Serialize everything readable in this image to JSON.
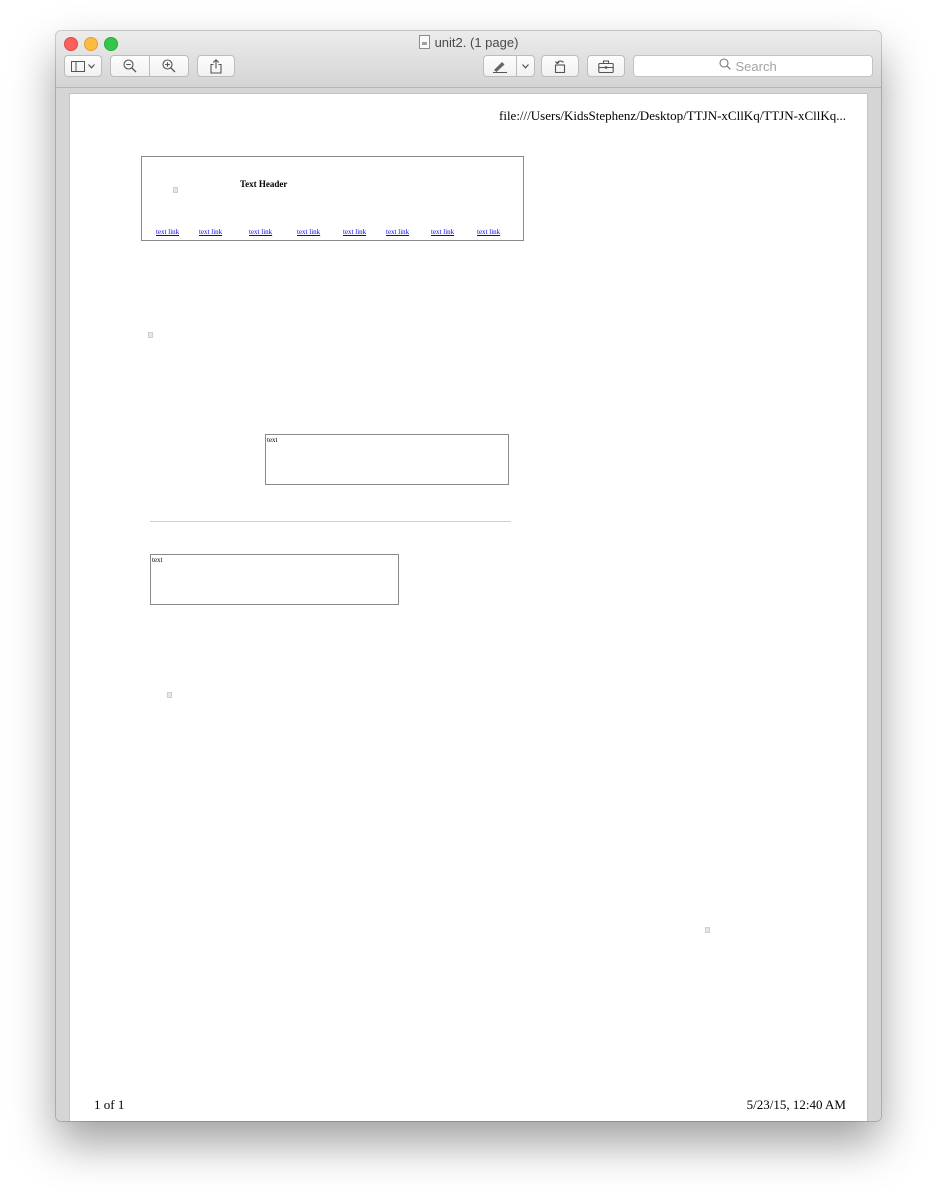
{
  "window": {
    "title": "unit2. (1 page)"
  },
  "toolbar": {
    "search_placeholder": "Search",
    "icons": [
      "sidebar-icon",
      "chevron-down-icon",
      "zoom-out-icon",
      "zoom-in-icon",
      "share-icon",
      "markup-pen-icon",
      "chevron-down-icon",
      "rotate-icon",
      "toolbox-icon",
      "search-icon"
    ]
  },
  "page": {
    "header_url": "file:///Users/KidsStephenz/Desktop/TTJN-xCllKq/TTJN-xCllKq...",
    "footer_page": "1 of 1",
    "footer_datetime": "5/23/15, 12:40 AM",
    "banner": {
      "title": "Text Header",
      "links": [
        "text link",
        "text link",
        "text link",
        "text link",
        "text link",
        "text link",
        "text link",
        "text link"
      ]
    },
    "textbox_1": "text",
    "textbox_2": "text"
  },
  "colors": {
    "link": "#0000ee",
    "close": "#fc605c",
    "minimize": "#fdbc40",
    "maximize": "#34c84a"
  }
}
